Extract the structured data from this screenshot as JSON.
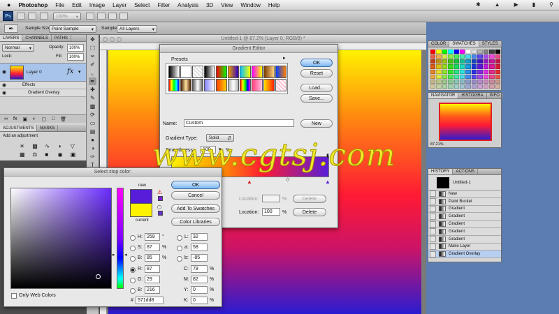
{
  "menubar": {
    "apple": "",
    "app": "Photoshop",
    "items": [
      "File",
      "Edit",
      "Image",
      "Layer",
      "Select",
      "Filter",
      "Analysis",
      "3D",
      "View",
      "Window",
      "Help"
    ]
  },
  "appbar": {
    "badge": "Ps",
    "zoom": "100%"
  },
  "options": {
    "sample_size_label": "Sample Size:",
    "sample_size_value": "Point Sample",
    "sample_label": "Sample:",
    "sample_value": "All Layers"
  },
  "document": {
    "title": "Untitled-1 @ 87.2% (Layer 0, RGB/8) *"
  },
  "layers_panel": {
    "tabs": [
      "LAYERS",
      "CHANNELS",
      "PATHS"
    ],
    "blend_mode": "Normal",
    "opacity_label": "Opacity:",
    "opacity_value": "100%",
    "lock_label": "Lock:",
    "fill_label": "Fill:",
    "fill_value": "100%",
    "layer_name": "Layer 0",
    "fx": "fx",
    "effects_label": "Effects",
    "effect_item": "Gradient Overlay"
  },
  "adjustments_panel": {
    "tabs": [
      "ADJUSTMENTS",
      "MASKS"
    ],
    "hint": "Add an adjustment"
  },
  "gradient_editor": {
    "title": "Gradient Editor",
    "presets_label": "Presets",
    "ok": "OK",
    "reset": "Reset",
    "load": "Load...",
    "save": "Save...",
    "name_label": "Name:",
    "name_value": "Custom",
    "new_button": "New",
    "gradient_type_label": "Gradient Type:",
    "gradient_type_value": "Solid",
    "smoothness_label": "Smoothness:",
    "smoothness_value": "100",
    "smoothness_unit": "%",
    "location_label": "Location:",
    "location_value": "100",
    "percent": "%",
    "delete": "Delete"
  },
  "color_picker": {
    "title": "Select stop color:",
    "ok": "OK",
    "cancel": "Cancel",
    "add_to_swatches": "Add To Swatches",
    "color_libraries": "Color Libraries",
    "new_label": "new",
    "current_label": "current",
    "new_color": "#571dd8",
    "current_color": "#fff200",
    "only_web_colors": "Only Web Colors",
    "fields": {
      "H": "259",
      "H_unit": "°",
      "S": "87",
      "S_unit": "%",
      "B": "85",
      "B_unit": "%",
      "R": "87",
      "G": "29",
      "Bl": "216",
      "L": "32",
      "a": "58",
      "b": "-85",
      "C": "78",
      "M": "82",
      "Y": "0",
      "K": "0",
      "pct": "%"
    },
    "hex_label": "#",
    "hex_value": "571dd8"
  },
  "swatches_panel": {
    "tabs": [
      "COLOR",
      "SWATCHES",
      "STYLES"
    ]
  },
  "navigator_panel": {
    "tabs": [
      "NAVIGATOR",
      "HISTOGRA",
      "INFO"
    ],
    "zoom": "87.21%"
  },
  "history_panel": {
    "tabs": [
      "HISTORY",
      "ACTIONS"
    ],
    "snapshot": "Untitled-1",
    "items": [
      "New",
      "Paint Bucket",
      "Gradient",
      "Gradient",
      "Gradient",
      "Gradient",
      "Gradient",
      "Make Layer",
      "Gradient Overlay"
    ]
  },
  "watermark": {
    "text": "www.cgtsj.com"
  },
  "colors": {
    "accent_blue": "#4f73a8",
    "watermark": "#f2ea2a"
  }
}
